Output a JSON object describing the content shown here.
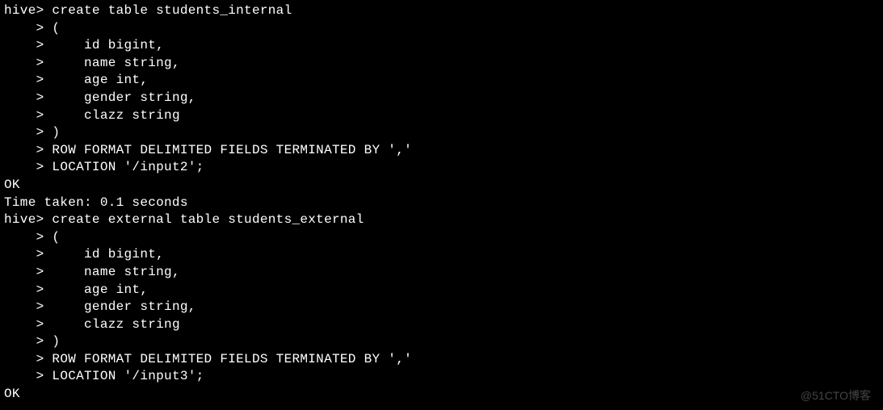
{
  "terminal": {
    "lines": [
      {
        "prefix": "hive> ",
        "text": "create table students_internal"
      },
      {
        "prefix": "    > ",
        "text": "("
      },
      {
        "prefix": "    > ",
        "text": "    id bigint,"
      },
      {
        "prefix": "    > ",
        "text": "    name string,"
      },
      {
        "prefix": "    > ",
        "text": "    age int,"
      },
      {
        "prefix": "    > ",
        "text": "    gender string,"
      },
      {
        "prefix": "    > ",
        "text": "    clazz string"
      },
      {
        "prefix": "    > ",
        "text": ")"
      },
      {
        "prefix": "    > ",
        "text": "ROW FORMAT DELIMITED FIELDS TERMINATED BY ','"
      },
      {
        "prefix": "    > ",
        "text": "LOCATION '/input2';"
      },
      {
        "prefix": "",
        "text": "OK"
      },
      {
        "prefix": "",
        "text": "Time taken: 0.1 seconds"
      },
      {
        "prefix": "hive> ",
        "text": "create external table students_external"
      },
      {
        "prefix": "    > ",
        "text": "("
      },
      {
        "prefix": "    > ",
        "text": "    id bigint,"
      },
      {
        "prefix": "    > ",
        "text": "    name string,"
      },
      {
        "prefix": "    > ",
        "text": "    age int,"
      },
      {
        "prefix": "    > ",
        "text": "    gender string,"
      },
      {
        "prefix": "    > ",
        "text": "    clazz string"
      },
      {
        "prefix": "    > ",
        "text": ")"
      },
      {
        "prefix": "    > ",
        "text": "ROW FORMAT DELIMITED FIELDS TERMINATED BY ','"
      },
      {
        "prefix": "    > ",
        "text": "LOCATION '/input3';"
      },
      {
        "prefix": "",
        "text": "OK"
      }
    ]
  },
  "watermark": "@51CTO博客"
}
